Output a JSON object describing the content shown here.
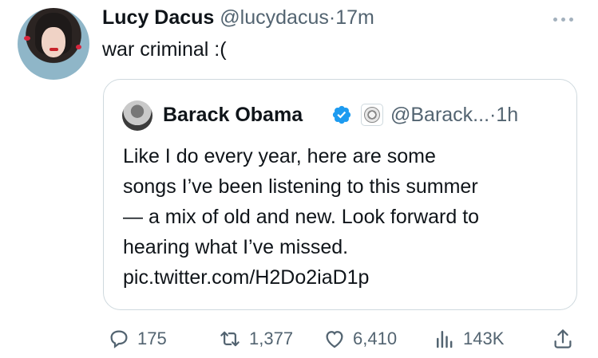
{
  "author": {
    "display_name": "Lucy Dacus",
    "handle": "@lucydacus",
    "separator": "·",
    "time": "17m"
  },
  "tweet": {
    "text": "war criminal :("
  },
  "quoted_tweet": {
    "display_name": "Barack Obama",
    "handle": "@Barack...",
    "separator": "·",
    "time": "1h",
    "lines": [
      "Like I do every year, here are some",
      "songs I’ve been listening to this summer",
      "— a mix of old and new. Look forward to",
      "hearing what I’ve missed.",
      "pic.twitter.com/H2Do2iaD1p"
    ]
  },
  "actions": {
    "replies": "175",
    "retweets": "1,377",
    "likes": "6,410",
    "views": "143K"
  },
  "colors": {
    "text": "#0f1419",
    "muted": "#536471",
    "verified_blue": "#1d9bf0",
    "border": "#cfd9de"
  },
  "icons": [
    "more-icon",
    "verified-icon",
    "government-seal-icon",
    "reply-icon",
    "retweet-icon",
    "like-icon",
    "views-icon",
    "share-icon"
  ]
}
